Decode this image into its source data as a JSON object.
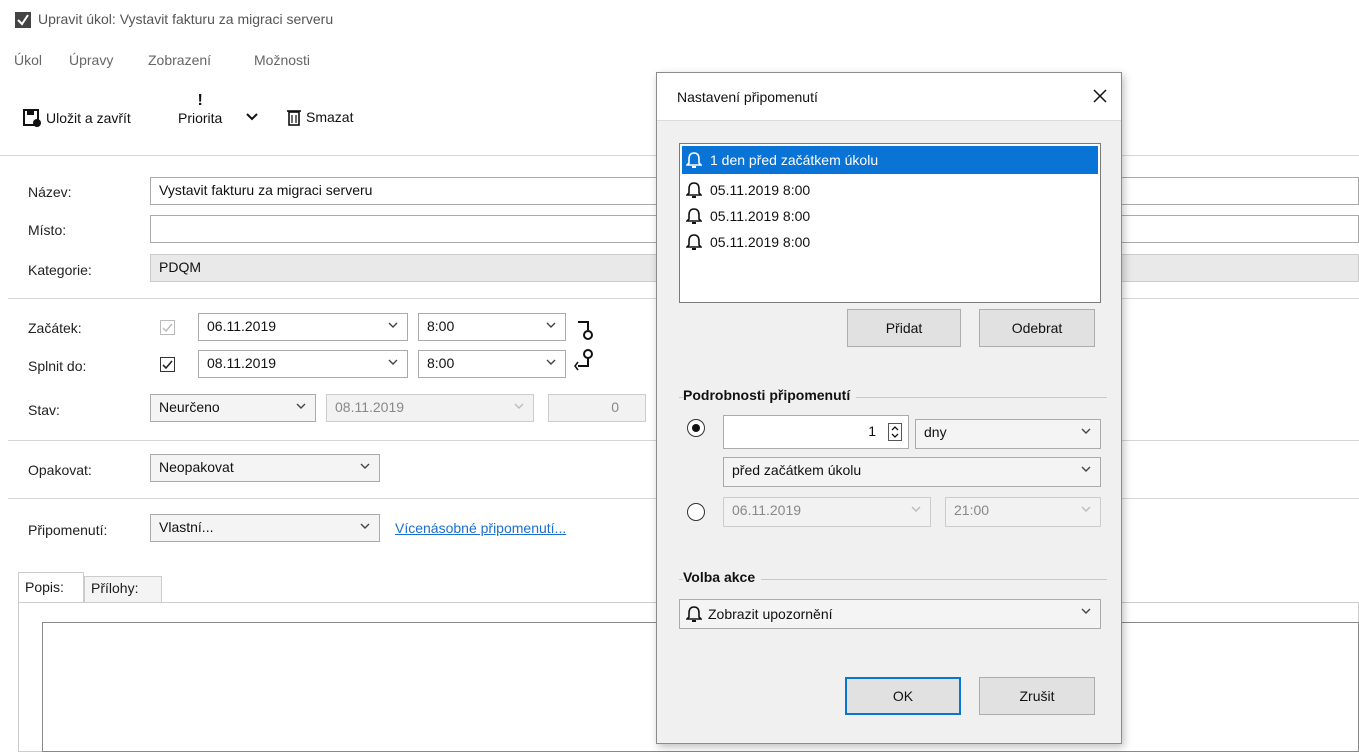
{
  "window": {
    "title": "Upravit úkol: Vystavit fakturu za migraci serveru"
  },
  "menu": [
    "Úkol",
    "Úpravy",
    "Zobrazení",
    "Možnosti"
  ],
  "toolbar": {
    "save_close": "Uložit a zavřít",
    "priority_mark": "!",
    "priority": "Priorita",
    "delete": "Smazat"
  },
  "form": {
    "name_label": "Název:",
    "name_value": "Vystavit fakturu za migraci serveru",
    "place_label": "Místo:",
    "place_value": "",
    "category_label": "Kategorie:",
    "category_value": "PDQM",
    "start_label": "Začátek:",
    "start_date": "06.11.2019",
    "start_time": "8:00",
    "due_label": "Splnit do:",
    "due_date": "08.11.2019",
    "due_time": "8:00",
    "status_label": "Stav:",
    "status_value": "Neurčeno",
    "status_date": "08.11.2019",
    "status_percent": "0",
    "repeat_label": "Opakovat:",
    "repeat_value": "Neopakovat",
    "reminder_label": "Připomenutí:",
    "reminder_value": "Vlastní...",
    "multi_reminder_link": "Vícenásobné připomenutí..."
  },
  "tabs": [
    "Popis:",
    "Přílohy:"
  ],
  "dialog": {
    "title": "Nastavení připomenutí",
    "reminders": [
      "1 den před začátkem úkolu",
      "05.11.2019 8:00",
      "05.11.2019 8:00",
      "05.11.2019 8:00"
    ],
    "add": "Přidat",
    "remove": "Odebrat",
    "details_title": "Podrobnosti připomenutí",
    "amount": "1",
    "unit": "dny",
    "relation": "před začátkem úkolu",
    "abs_date": "06.11.2019",
    "abs_time": "21:00",
    "action_title": "Volba akce",
    "action_value": "Zobrazit upozornění",
    "ok": "OK",
    "cancel": "Zrušit"
  },
  "colors": {
    "selection": "#0a74d6",
    "link": "#1a6fd1"
  }
}
